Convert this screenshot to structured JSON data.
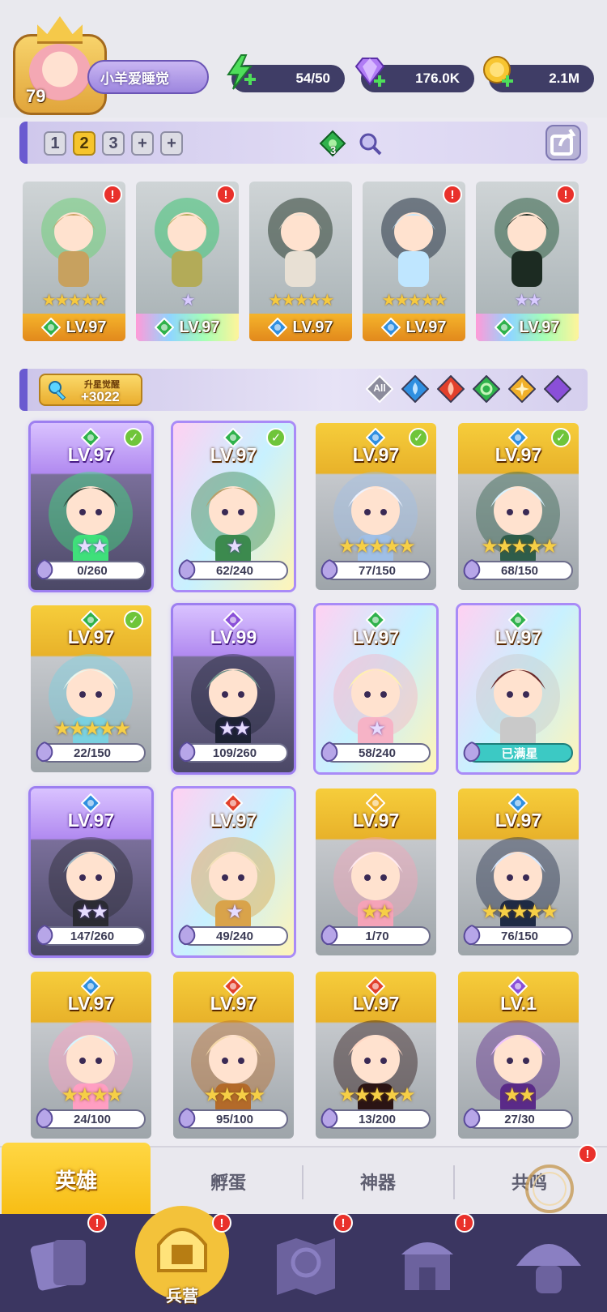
{
  "player": {
    "level": "79",
    "name": "小羊爱睡觉"
  },
  "resources": {
    "energy": "54/50",
    "gems": "176.0K",
    "gold": "2.1M"
  },
  "team_bar": {
    "tabs": [
      "1",
      "2",
      "3"
    ],
    "active_tab": "2",
    "gem_count": "3"
  },
  "team": [
    {
      "level": "LV.97",
      "element": "green",
      "stars": "★★★★★",
      "star_color": "gold",
      "alert": "!"
    },
    {
      "level": "LV.97",
      "element": "green",
      "stars": "★",
      "star_color": "purple",
      "alert": "!"
    },
    {
      "level": "LV.97",
      "element": "blue",
      "stars": "★★★★★",
      "star_color": "gold",
      "alert": ""
    },
    {
      "level": "LV.97",
      "element": "blue",
      "stars": "★★★★★",
      "star_color": "gold",
      "alert": "!"
    },
    {
      "level": "LV.97",
      "element": "green",
      "stars": "★★",
      "star_color": "purple",
      "alert": "!"
    }
  ],
  "filter_bar": {
    "awaken_label": "升星觉醒",
    "awaken_value": "+3022",
    "all_label": "All"
  },
  "heroes": [
    {
      "level": "LV.97",
      "element": "green",
      "frame": "purple",
      "stars": "★★",
      "star_color": "purple",
      "progress": "0/260",
      "checked": true
    },
    {
      "level": "LV.97",
      "element": "green",
      "frame": "rainbow",
      "stars": "★",
      "star_color": "purple",
      "progress": "62/240",
      "checked": true
    },
    {
      "level": "LV.97",
      "element": "blue",
      "frame": "gold",
      "stars": "★★★★★",
      "star_color": "gold",
      "progress": "77/150",
      "checked": true
    },
    {
      "level": "LV.97",
      "element": "blue",
      "frame": "gold",
      "stars": "★★★★★",
      "star_color": "gold",
      "progress": "68/150",
      "checked": true
    },
    {
      "level": "LV.97",
      "element": "green",
      "frame": "gold",
      "stars": "★★★★★",
      "star_color": "gold",
      "progress": "22/150",
      "checked": true
    },
    {
      "level": "LV.99",
      "element": "purple",
      "frame": "purple",
      "stars": "★★",
      "star_color": "purple",
      "progress": "109/260",
      "checked": false
    },
    {
      "level": "LV.97",
      "element": "green",
      "frame": "rainbow",
      "stars": "★",
      "star_color": "purple",
      "progress": "58/240",
      "checked": false
    },
    {
      "level": "LV.97",
      "element": "green",
      "frame": "rainbow",
      "stars": "",
      "star_color": "purple",
      "progress": "已满星",
      "checked": false
    },
    {
      "level": "LV.97",
      "element": "blue",
      "frame": "purple",
      "stars": "★★",
      "star_color": "purple",
      "progress": "147/260",
      "checked": false
    },
    {
      "level": "LV.97",
      "element": "red",
      "frame": "rainbow",
      "stars": "★",
      "star_color": "purple",
      "progress": "49/240",
      "checked": false
    },
    {
      "level": "LV.97",
      "element": "yellow",
      "frame": "gold",
      "stars": "★★",
      "star_color": "gold",
      "progress": "1/70",
      "checked": false
    },
    {
      "level": "LV.97",
      "element": "blue",
      "frame": "gold",
      "stars": "★★★★★",
      "star_color": "gold",
      "progress": "76/150",
      "checked": false
    },
    {
      "level": "LV.97",
      "element": "blue",
      "frame": "gold",
      "stars": "★★★★",
      "star_color": "gold",
      "progress": "24/100",
      "checked": false
    },
    {
      "level": "LV.97",
      "element": "red",
      "frame": "gold",
      "stars": "★★★★",
      "star_color": "gold",
      "progress": "95/100",
      "checked": false
    },
    {
      "level": "LV.97",
      "element": "red",
      "frame": "gold",
      "stars": "★★★★★",
      "star_color": "gold",
      "progress": "13/200",
      "checked": false
    },
    {
      "level": "LV.1",
      "element": "purple",
      "frame": "gold",
      "stars": "★★",
      "star_color": "gold",
      "progress": "27/30",
      "checked": false
    }
  ],
  "sub_tabs": [
    "英雄",
    "孵蛋",
    "神器",
    "共鸣"
  ],
  "nav": {
    "barracks_label": "兵营"
  },
  "colors": {
    "green": "#2fb24b",
    "blue": "#2f8fe0",
    "red": "#e2402b",
    "yellow": "#f0b02a",
    "purple": "#8a4fd8",
    "alert": "#e9312b"
  }
}
